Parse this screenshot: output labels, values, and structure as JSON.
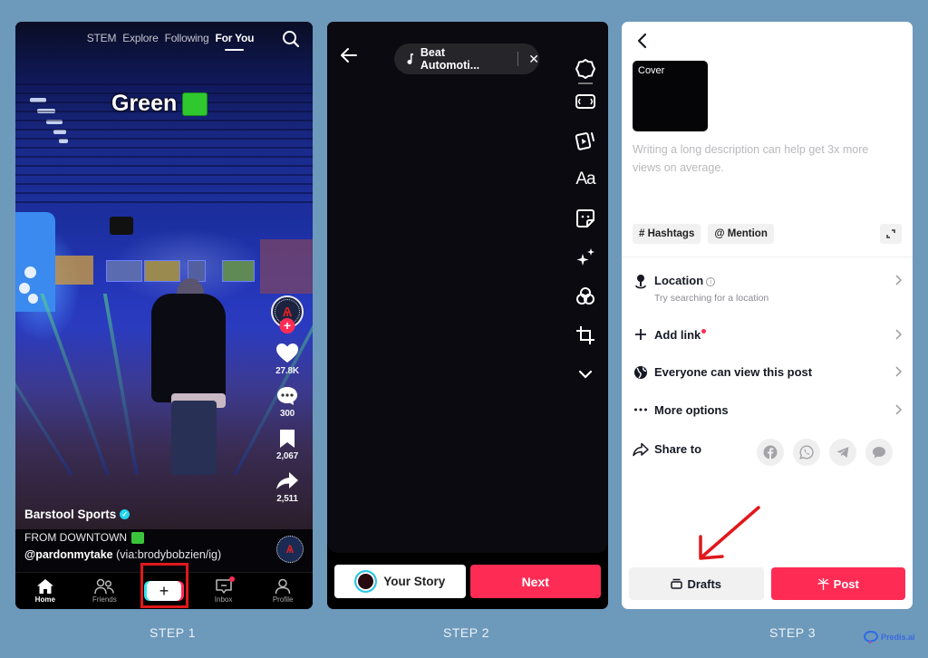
{
  "step1": {
    "top_tabs": [
      "STEM",
      "Explore",
      "Following",
      "For You"
    ],
    "active_tab": "For You",
    "overlay_text": "Green",
    "actions": {
      "likes": "27.8K",
      "comments": "300",
      "saves": "2,067",
      "shares": "2,511"
    },
    "creator_name": "Barstool Sports",
    "caption": "FROM DOWNTOWN",
    "handle": "@pardonmytake",
    "handle_suffix": "(via:brodybobzien/ig)",
    "avatar_mark": "Ѧ",
    "nav": [
      {
        "label": "Home",
        "icon": "home-icon"
      },
      {
        "label": "Friends",
        "icon": "friends-icon"
      },
      {
        "label": "",
        "icon": "create-plus-icon"
      },
      {
        "label": "Inbox",
        "icon": "inbox-icon"
      },
      {
        "label": "Profile",
        "icon": "profile-icon"
      }
    ],
    "create_symbol": "+"
  },
  "step2": {
    "music_title": "Beat Automoti...",
    "tools": [
      "settings",
      "video-frame",
      "clip",
      "text",
      "sticker",
      "effects",
      "filters",
      "crop",
      "more"
    ],
    "text_tool_label": "Aa",
    "story_button": "Your Story",
    "next_button": "Next"
  },
  "step3": {
    "cover_label": "Cover",
    "description_placeholder": "Writing a long description can help get 3x more views on average.",
    "chips": [
      "# Hashtags",
      "@ Mention"
    ],
    "rows": {
      "location": {
        "label": "Location",
        "sub": "Try searching for a location"
      },
      "add_link": {
        "label": "Add link"
      },
      "visibility": {
        "label": "Everyone can view this post"
      },
      "more_options": {
        "label": "More options"
      },
      "share_to": {
        "label": "Share to"
      }
    },
    "share_targets": [
      "facebook",
      "whatsapp",
      "telegram",
      "message"
    ],
    "drafts_button": "Drafts",
    "post_button": "Post"
  },
  "captions": {
    "step1": "STEP 1",
    "step2": "STEP 2",
    "step3": "STEP 3",
    "brand": "Predis.ai"
  },
  "colors": {
    "background": "#6d99bb",
    "accent": "#fe2c55",
    "highlight_box": "#e0181b"
  }
}
